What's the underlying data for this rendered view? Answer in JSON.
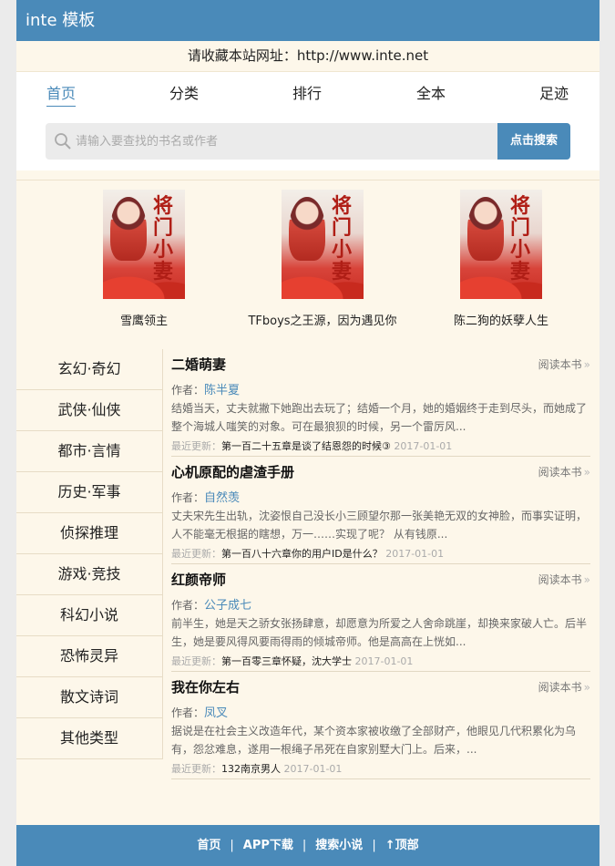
{
  "header": {
    "title": "inte 模板"
  },
  "notice": "请收藏本站网址：http://www.inte.net",
  "nav": [
    {
      "label": "首页",
      "active": true
    },
    {
      "label": "分类"
    },
    {
      "label": "排行"
    },
    {
      "label": "全本"
    },
    {
      "label": "足迹"
    }
  ],
  "search": {
    "placeholder": "请输入要查找的书名或作者",
    "button": "点击搜索"
  },
  "featured": [
    {
      "name": "雪鹰领主",
      "cover_title": "将门小妻"
    },
    {
      "name": "TFboys之王源，因为遇见你",
      "cover_title": "将门小妻"
    },
    {
      "name": "陈二狗的妖孽人生",
      "cover_title": "将门小妻"
    }
  ],
  "categories": [
    "玄幻·奇幻",
    "武侠·仙侠",
    "都市·言情",
    "历史·军事",
    "侦探推理",
    "游戏·竞技",
    "科幻小说",
    "恐怖灵异",
    "散文诗词",
    "其他类型"
  ],
  "books": [
    {
      "title": "二婚萌妻",
      "read_label": "阅读本书",
      "author_label": "作者：",
      "author": "陈半夏",
      "desc": "结婚当天，丈夫就撇下她跑出去玩了；结婚一个月，她的婚姻终于走到尽头，而她成了整个海城人嗤笑的对象。可在最狼狈的时候，另一个雷厉风...",
      "update_label": "最近更新：",
      "chapter": "第一百二十五章是谈了结恩怨的时候③",
      "date": "2017-01-01"
    },
    {
      "title": "心机原配的虐渣手册",
      "read_label": "阅读本书",
      "author_label": "作者：",
      "author": "自然羡",
      "desc": "丈夫宋先生出轨，沈姿恨自己没长小三顾望尔那一张美艳无双的女神脸，而事实证明，人不能毫无根据的瞎想，万一……实现了呢？        从有钱原...",
      "update_label": "最近更新：",
      "chapter": "第一百八十六章你的用户ID是什么？",
      "date": "2017-01-01"
    },
    {
      "title": "红颜帝师",
      "read_label": "阅读本书",
      "author_label": "作者：",
      "author": "公子成七",
      "desc": "前半生，她是天之骄女张扬肆意，却愿意为所爱之人舍命跳崖，却换来家破人亡。后半生，她是要风得风要雨得雨的倾城帝师。他是高高在上恍如...",
      "update_label": "最近更新：",
      "chapter": "第一百零三章怀疑，沈大学士",
      "date": "2017-01-01"
    },
    {
      "title": "我在你左右",
      "read_label": "阅读本书",
      "author_label": "作者：",
      "author": "凤叉",
      "desc": "据说是在社会主义改造年代，某个资本家被收缴了全部财产，他眼见几代积累化为乌有，怨忿难息，遂用一根绳子吊死在自家别墅大门上。后来，...",
      "update_label": "最近更新：",
      "chapter": "132南京男人",
      "date": "2017-01-01"
    }
  ],
  "footer": [
    "首页",
    "APP下载",
    "搜索小说",
    "↑顶部"
  ],
  "colors": {
    "accent": "#4a8ab9",
    "background": "#fdf7ea"
  }
}
